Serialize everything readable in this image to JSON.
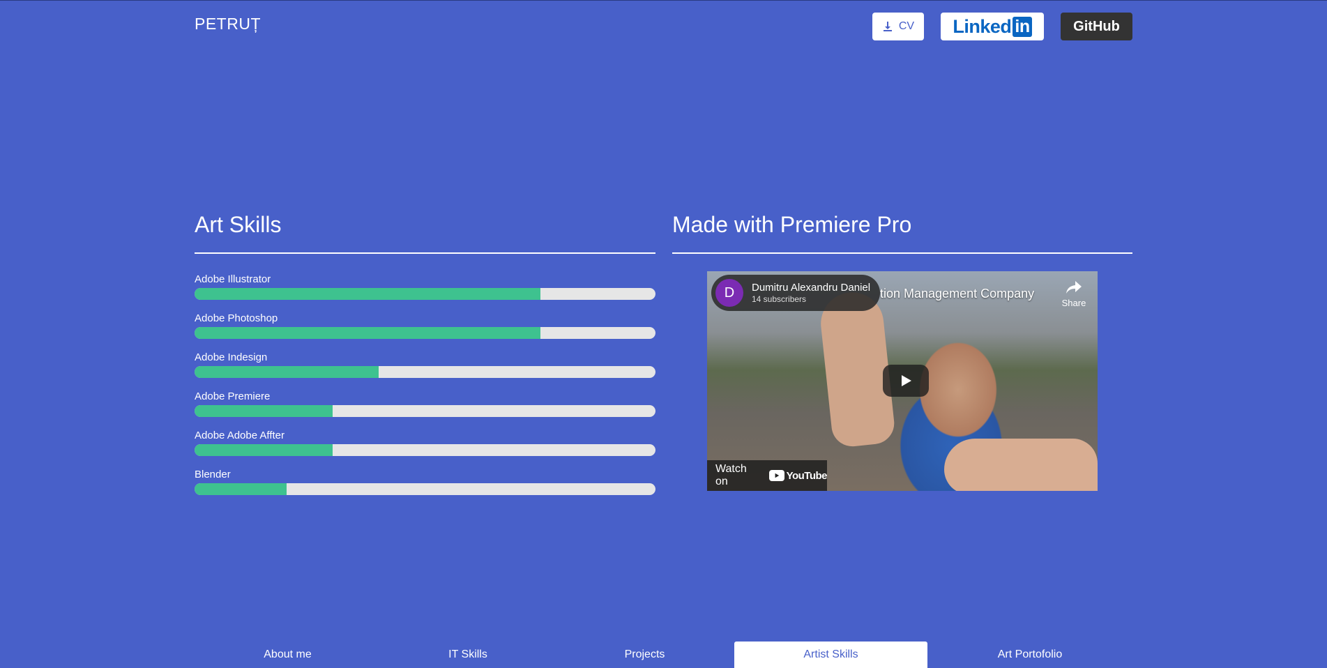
{
  "header": {
    "logo": "PETRUȚ",
    "cv_label": "CV",
    "linkedin_word": "Linked",
    "linkedin_box": "in",
    "github_label": "GitHub"
  },
  "art_skills": {
    "title": "Art Skills",
    "skills": [
      {
        "label": "Adobe Illustrator",
        "level": 0.75
      },
      {
        "label": "Adobe Photoshop",
        "level": 0.75
      },
      {
        "label": "Adobe Indesign",
        "level": 0.4
      },
      {
        "label": "Adobe Premiere",
        "level": 0.3
      },
      {
        "label": "Adobe Adobe Affter",
        "level": 0.3
      },
      {
        "label": "Blender",
        "level": 0.2
      }
    ]
  },
  "premiere": {
    "title": "Made with Premiere Pro",
    "video": {
      "channel_initial": "D",
      "channel_name": "Dumitru Alexandru Daniel",
      "subscribers": "14 subscribers",
      "title_fragment": "tion Management Company",
      "share_label": "Share",
      "watch_on": "Watch on",
      "youtube": "YouTube"
    }
  },
  "nav": {
    "tabs": [
      {
        "label": "About me",
        "active": false
      },
      {
        "label": "IT Skills",
        "active": false
      },
      {
        "label": "Projects",
        "active": false
      },
      {
        "label": "Artist Skills",
        "active": true
      },
      {
        "label": "Art Portofolio",
        "active": false
      }
    ]
  },
  "colors": {
    "background": "#4860c9",
    "progress_fill": "#3ec28f",
    "progress_track": "#e6e6e6",
    "github_button": "#333333",
    "linkedin_blue": "#0a66c2"
  }
}
